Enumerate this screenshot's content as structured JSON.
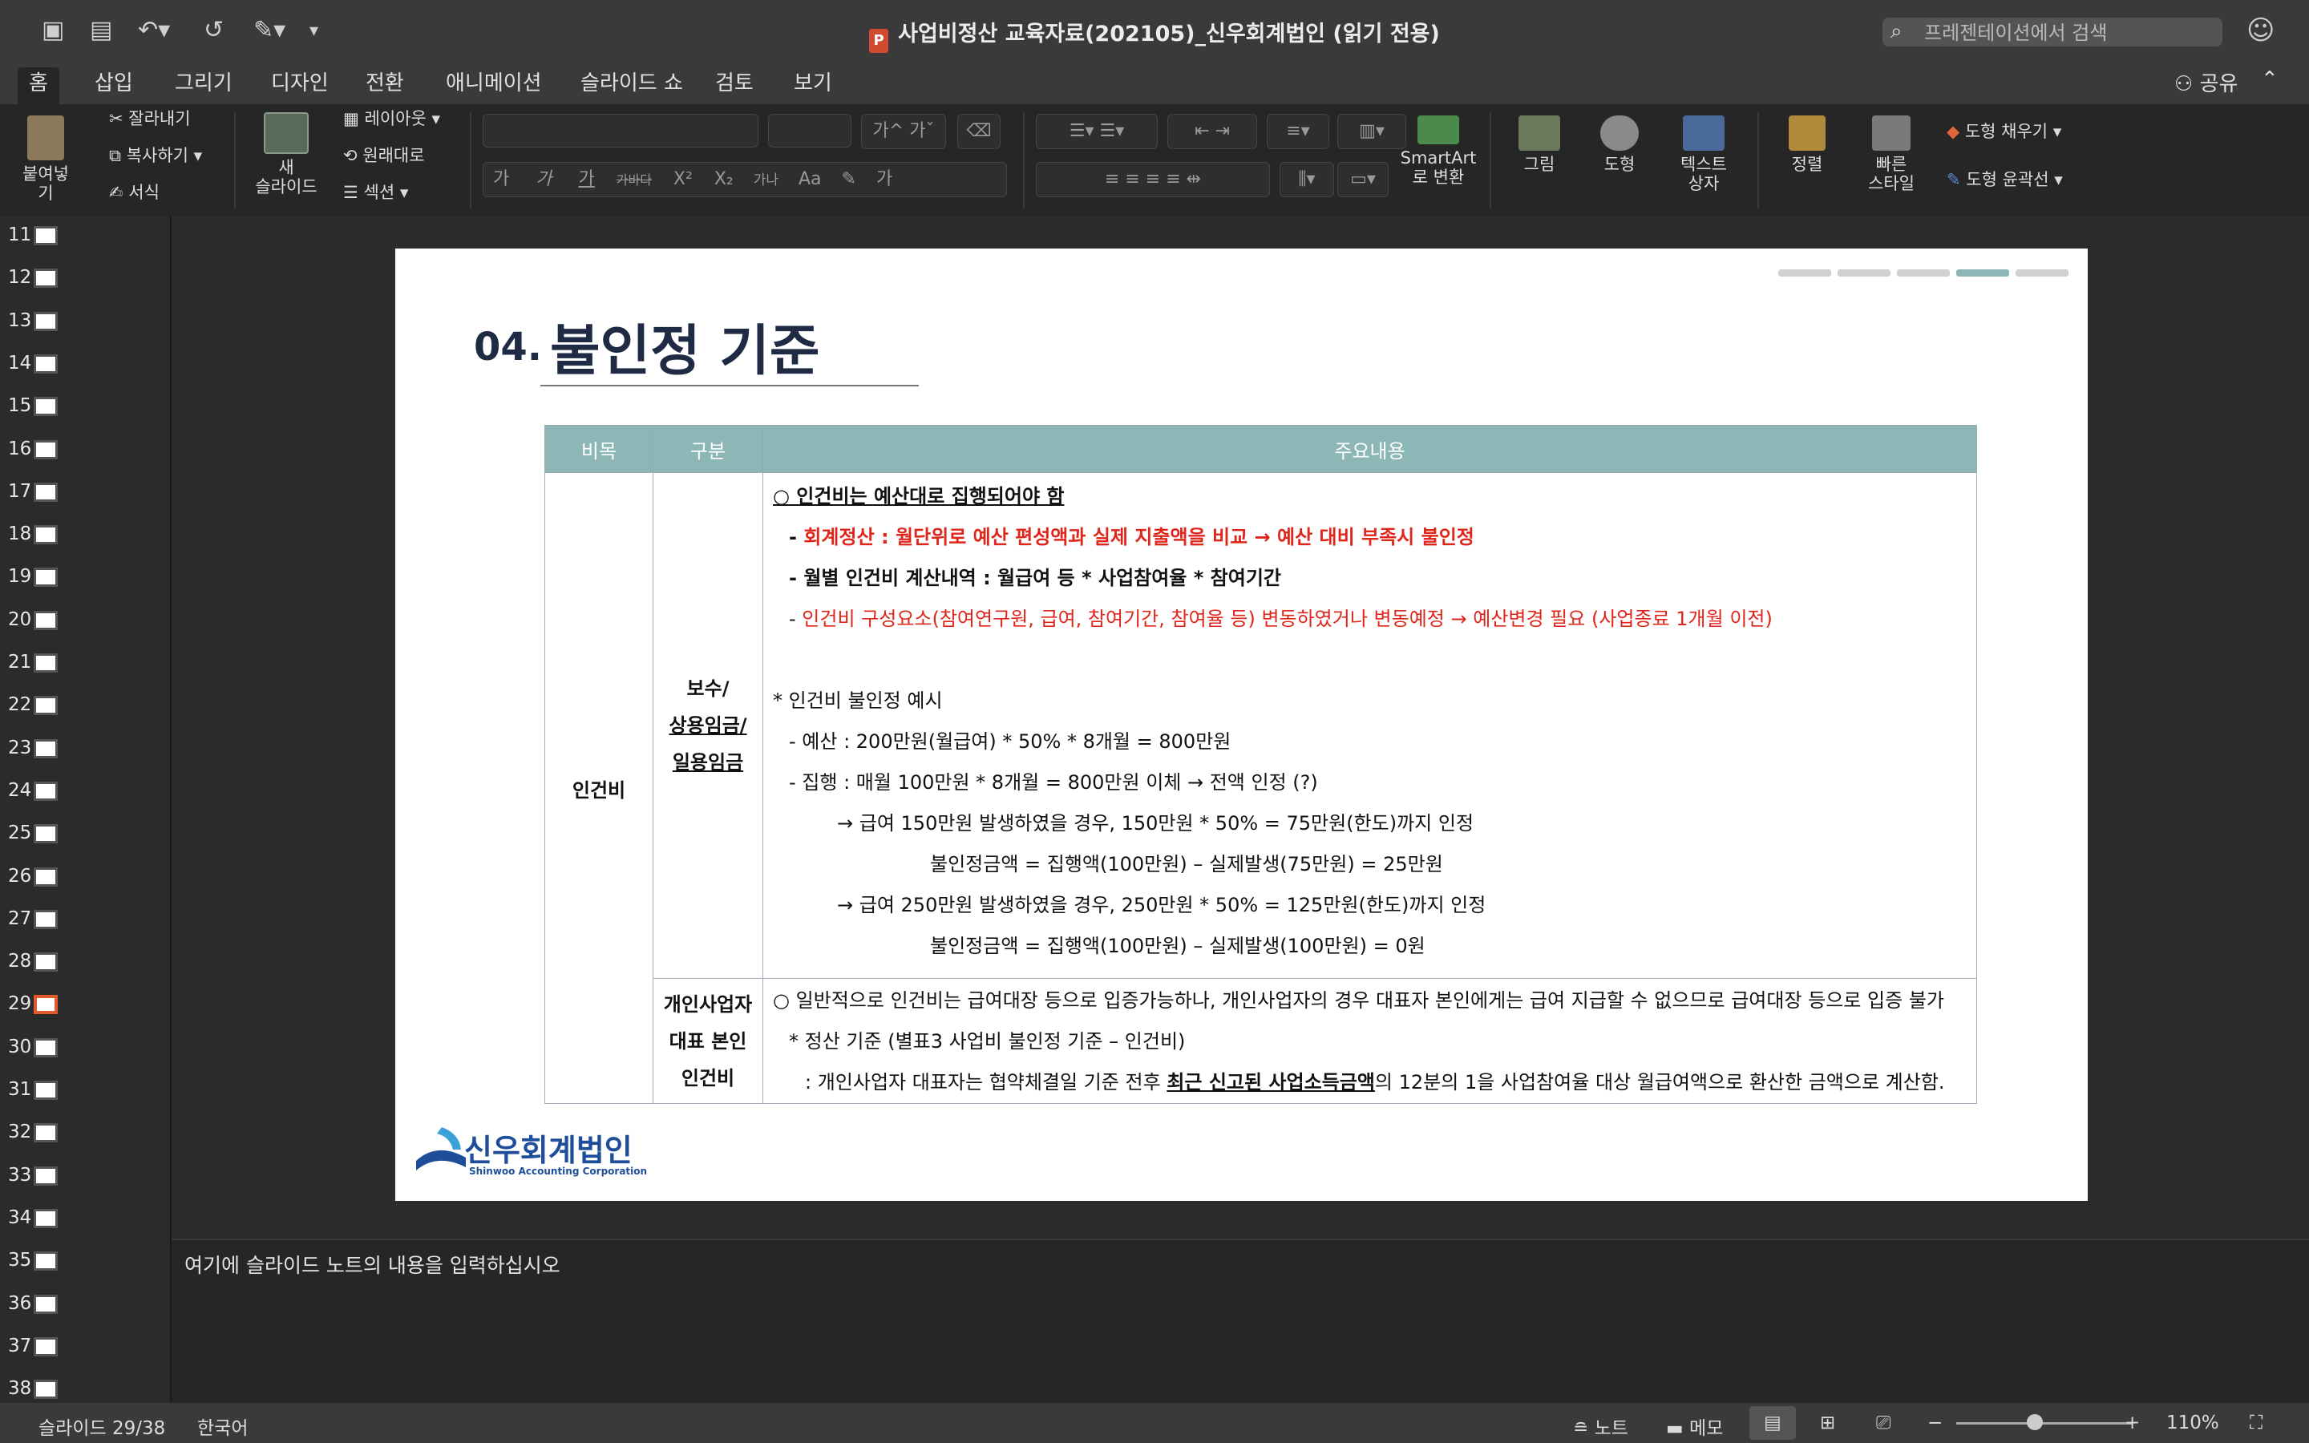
{
  "window": {
    "title": "사업비정산 교육자료(202105)_신우회계법인 (읽기 전용)",
    "search_placeholder": "프레젠테이션에서 검색"
  },
  "tabs": [
    "홈",
    "삽입",
    "그리기",
    "디자인",
    "전환",
    "애니메이션",
    "슬라이드 쇼",
    "검토",
    "보기"
  ],
  "share_label": "공유",
  "ribbon": {
    "paste": "붙여넣기",
    "cut": "잘라내기",
    "copy": "복사하기",
    "format": "서식",
    "new_slide_1": "새",
    "new_slide_2": "슬라이드",
    "layout": "레이아웃",
    "reset": "원래대로",
    "section": "섹션",
    "smartart_1": "SmartArt",
    "smartart_2": "로 변환",
    "picture": "그림",
    "shape": "도형",
    "textbox_1": "텍스트",
    "textbox_2": "상자",
    "arrange": "정렬",
    "quickstyle_1": "빠른",
    "quickstyle_2": "스타일",
    "shape_fill": "도형 채우기",
    "shape_outline": "도형 윤곽선",
    "font_btns": [
      "가",
      "가"
    ],
    "style_btns": [
      "가",
      "가",
      "가",
      "가바다",
      "X²",
      "X₂",
      "가나",
      "Aa",
      "가"
    ]
  },
  "slide_numbers": [
    "11",
    "12",
    "13",
    "14",
    "15",
    "16",
    "17",
    "18",
    "19",
    "20",
    "21",
    "22",
    "23",
    "24",
    "25",
    "26",
    "27",
    "28",
    "29",
    "30",
    "31",
    "32",
    "33",
    "34",
    "35",
    "36",
    "37",
    "38"
  ],
  "selected_slide": "29",
  "slide": {
    "number": "04.",
    "title": "불인정 기준",
    "headers": [
      "비목",
      "구분",
      "주요내용"
    ],
    "category": "인건비",
    "sub1": [
      "보수/",
      "상용임금/",
      "일용임금"
    ],
    "sub2": [
      "개인사업자",
      "대표 본인",
      "인건비"
    ],
    "l1": "○ 인건비는 예산대로 집행되어야 함",
    "l2_prefix": "- ",
    "l2": "회계정산 : 월단위로 예산 편성액과 실제 지출액을 비교 → 예산 대비 부족시 불인정",
    "l3": "- 월별 인건비 계산내역 : 월급여 등 * 사업참여율 * 참여기간",
    "l4_prefix": "- ",
    "l4": "인건비 구성요소(참여연구원, 급여, 참여기간, 참여율 등) 변동하였거나 변동예정 → 예산변경 필요 (사업종료 1개월 이전)",
    "l5": "* 인건비 불인정 예시",
    "l6": "- 예산 : 200만원(월급여) * 50% * 8개월 = 800만원",
    "l7": "- 집행 : 매월 100만원 * 8개월 = 800만원 이체      → 전액 인정 (?)",
    "l8": "→ 급여 150만원 발생하였을 경우, 150만원 * 50% = 75만원(한도)까지 인정",
    "l9": "불인정금액 = 집행액(100만원) – 실제발생(75만원)  = 25만원",
    "l10": "→ 급여 250만원 발생하였을 경우, 250만원 * 50% = 125만원(한도)까지 인정",
    "l11": "불인정금액 = 집행액(100만원) – 실제발생(100만원) = 0원",
    "m1": "○ 일반적으로 인건비는 급여대장 등으로 입증가능하나, 개인사업자의 경우 대표자 본인에게는 급여 지급할 수 없으므로 급여대장 등으로 입증 불가",
    "m2": "* 정산 기준 (별표3 사업비 불인정 기준 – 인건비)",
    "m3a": ": 개인사업자 대표자는 협약체결일 기준 전후 ",
    "m3b": "최근 신고된 사업소득금액",
    "m3c": "의 12분의 1을 사업참여율 대상 월급여액으로 환산한 금액으로 계산함.",
    "logo_kr": "신우회계법인",
    "logo_en": "Shinwoo Accounting Corporation"
  },
  "notes_placeholder": "여기에 슬라이드 노트의 내용을 입력하십시오",
  "status": {
    "slide": "슬라이드 29/38",
    "lang": "한국어",
    "notes": "노트",
    "comments": "메모",
    "zoom": "110%"
  }
}
